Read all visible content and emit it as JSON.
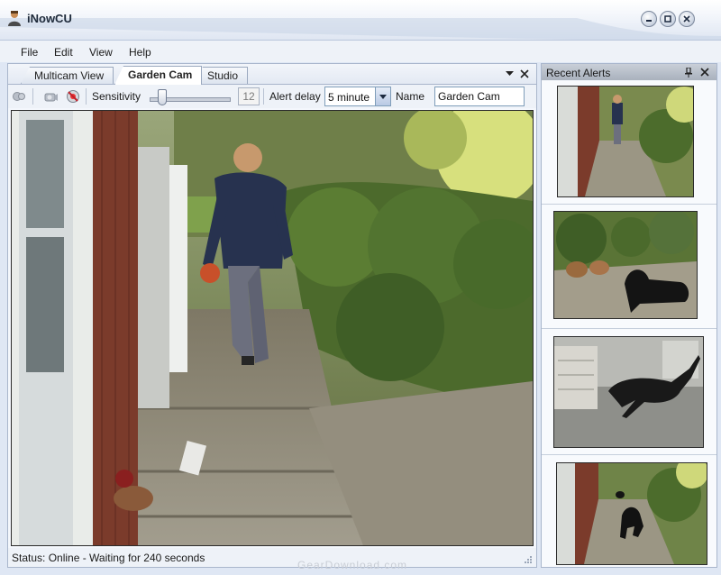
{
  "window": {
    "title": "iNowCU"
  },
  "menu": [
    "File",
    "Edit",
    "View",
    "Help"
  ],
  "tabs": [
    {
      "label": "Multicam View",
      "active": false
    },
    {
      "label": "Garden Cam",
      "active": true
    },
    {
      "label": "Studio",
      "active": false
    }
  ],
  "toolbar": {
    "sensitivity_label": "Sensitivity",
    "sensitivity_value": "12",
    "alert_delay_label": "Alert delay",
    "alert_delay_value": "5 minute",
    "name_label": "Name",
    "name_value": "Garden Cam"
  },
  "status": {
    "text": "Status:  Online - Waiting for 240 seconds"
  },
  "alerts_panel": {
    "title": "Recent Alerts"
  },
  "watermark": "GearDownload.com",
  "colors": {
    "accent": "#7f9db9",
    "panel_header": "#a9b1bd"
  }
}
